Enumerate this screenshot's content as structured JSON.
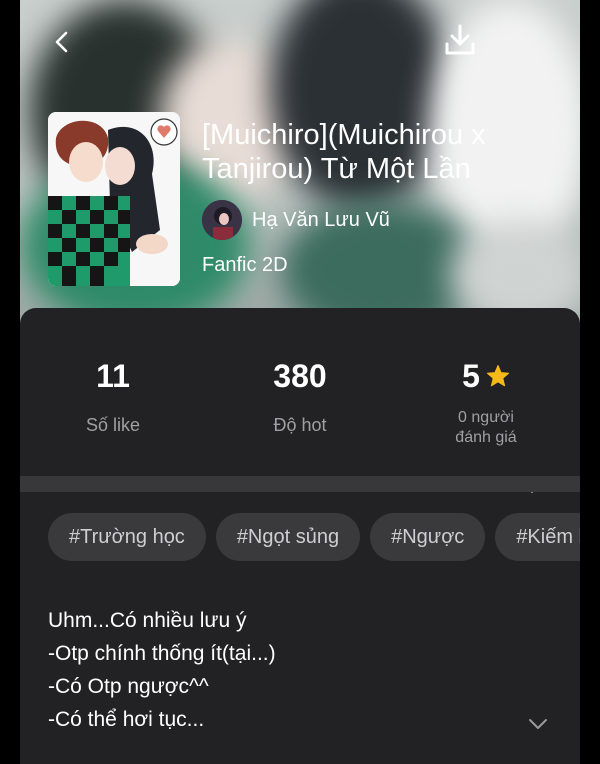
{
  "header": {
    "back_icon": "chevron-left-icon",
    "download_icon": "download-icon"
  },
  "story": {
    "title_line1": "[Muichiro](Muichirou x",
    "title_line2": "Tanjirou) Từ Một Lần",
    "author": "Hạ Văn Lưu Vũ",
    "genre": "Fanfic 2D"
  },
  "stats": {
    "likes": {
      "value": "11",
      "label": "Số like"
    },
    "hot": {
      "value": "380",
      "label": "Độ hot"
    },
    "rating": {
      "value": "5",
      "label_line1": "0 người",
      "label_line2": "đánh giá",
      "star_color": "#f5b91a"
    }
  },
  "tags": [
    "#Trường học",
    "#Ngọt sủng",
    "#Ngược",
    "#Kiếm hiệp"
  ],
  "description": [
    "Uhm...Có nhiều lưu ý",
    "-Otp chính thống ít(tại...)",
    "-Có Otp ngược^^",
    "-Có thể hơi tục..."
  ]
}
